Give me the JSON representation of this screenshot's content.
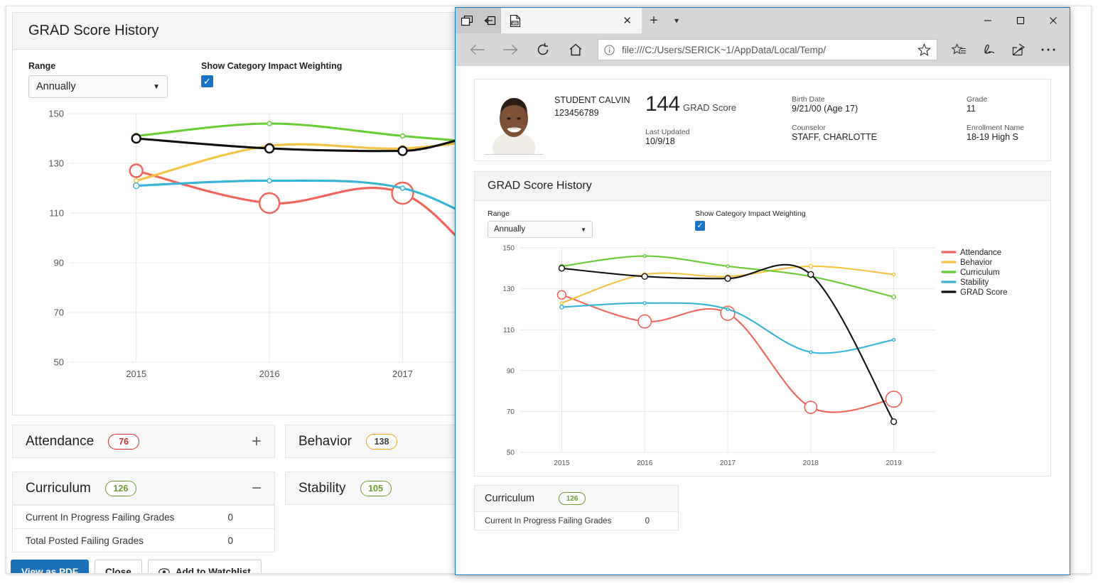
{
  "colors": {
    "attendance": "#f2645a",
    "behavior": "#f5c242",
    "curriculum": "#66cc33",
    "stability": "#34b5d8",
    "grad": "#111111",
    "accent": "#1b71b8",
    "edge_border": "#0c7ac0",
    "pill_red": "#cc2b2b",
    "pill_green": "#6d9a2f",
    "pill_amber": "#e8a317"
  },
  "back_app": {
    "panel_title": "GRAD Score History",
    "range_label": "Range",
    "range_value": "Annually",
    "weighting_label": "Show Category Impact Weighting",
    "weighting_checked": true,
    "categories": [
      {
        "name": "Attendance",
        "score": "76",
        "pill_color": "#cc2b2b",
        "toggle": "+",
        "rows": []
      },
      {
        "name": "Behavior",
        "score": "138",
        "pill_color": "#e8a317",
        "toggle": "",
        "rows": []
      },
      {
        "name": "Curriculum",
        "score": "126",
        "pill_color": "#6d9a2f",
        "toggle": "−",
        "rows": [
          {
            "label": "Current In Progress Failing Grades",
            "value": "0"
          },
          {
            "label": "Total Posted Failing Grades",
            "value": "0"
          }
        ]
      },
      {
        "name": "Stability",
        "score": "105",
        "pill_color": "#6d9a2f",
        "toggle": "",
        "rows": []
      }
    ],
    "buttons": [
      {
        "label": "View as PDF",
        "icon": "",
        "primary": true
      },
      {
        "label": "Close",
        "icon": "",
        "primary": false
      },
      {
        "label": "Add to Watchlist",
        "icon": "eye-icon",
        "primary": false
      }
    ]
  },
  "browser": {
    "tab_title": "",
    "tab_favicon": "pdf-icon",
    "url": "file:///C:/Users/SERICK~1/AppData/Local/Temp/",
    "nav": {
      "back": "back-arrow-icon",
      "forward": "forward-arrow-icon",
      "refresh": "refresh-icon",
      "home": "home-icon",
      "info": "info-icon",
      "favorite": "star-icon"
    },
    "tools": [
      "favorites-hub-icon",
      "web-note-icon",
      "share-icon",
      "more-icon"
    ],
    "window_controls": [
      "minimize",
      "maximize",
      "close"
    ],
    "tabs_aside": [
      "tabs-aside-icon",
      "tabs-restore-icon"
    ]
  },
  "student": {
    "name": "STUDENT CALVIN",
    "id": "123456789",
    "grad_score": "144",
    "grad_score_label": "GRAD Score",
    "last_updated_label": "Last Updated",
    "last_updated": "10/9/18",
    "birth_date_label": "Birth Date",
    "birth_date": "9/21/00 (Age 17)",
    "grade_label": "Grade",
    "grade": "11",
    "counselor_label": "Counselor",
    "counselor": "STAFF, CHARLOTTE",
    "enrollment_label": "Enrollment Name",
    "enrollment": "18-19 High S"
  },
  "inner_panel": {
    "title": "GRAD Score History",
    "range_label": "Range",
    "range_value": "Annually",
    "weighting_label": "Show Category Impact Weighting",
    "curriculum_name": "Curriculum",
    "curriculum_score": "126",
    "curriculum_row_label": "Current In Progress Failing Grades",
    "curriculum_row_value": "0"
  },
  "chart_data": {
    "type": "line",
    "title": "GRAD Score History",
    "xlabel": "",
    "ylabel": "",
    "x": [
      "2015",
      "2016",
      "2017",
      "2018",
      "2019"
    ],
    "ylim": [
      50,
      150
    ],
    "yticks": [
      50,
      70,
      90,
      110,
      130,
      150
    ],
    "grid": true,
    "legend_position": "right",
    "series": [
      {
        "name": "Attendance",
        "color": "#f2645a",
        "values": [
          127,
          114,
          118,
          72,
          76
        ],
        "marker_sizes": [
          9,
          14,
          15,
          13,
          17
        ]
      },
      {
        "name": "Behavior",
        "color": "#f5c242",
        "values": [
          123,
          137,
          136,
          141,
          137
        ],
        "marker_sizes": [
          3,
          4,
          4,
          4,
          3
        ]
      },
      {
        "name": "Curriculum",
        "color": "#66cc33",
        "values": [
          141,
          146,
          141,
          136,
          126
        ],
        "marker_sizes": [
          4,
          3,
          3,
          3,
          4
        ]
      },
      {
        "name": "Stability",
        "color": "#34b5d8",
        "values": [
          121,
          123,
          120,
          99,
          105
        ],
        "marker_sizes": [
          4,
          3,
          3,
          3,
          3
        ]
      },
      {
        "name": "GRAD Score",
        "color": "#111111",
        "values": [
          140,
          136,
          135,
          137,
          65
        ],
        "marker_sizes": [
          6,
          6,
          6,
          6,
          6
        ]
      }
    ]
  }
}
